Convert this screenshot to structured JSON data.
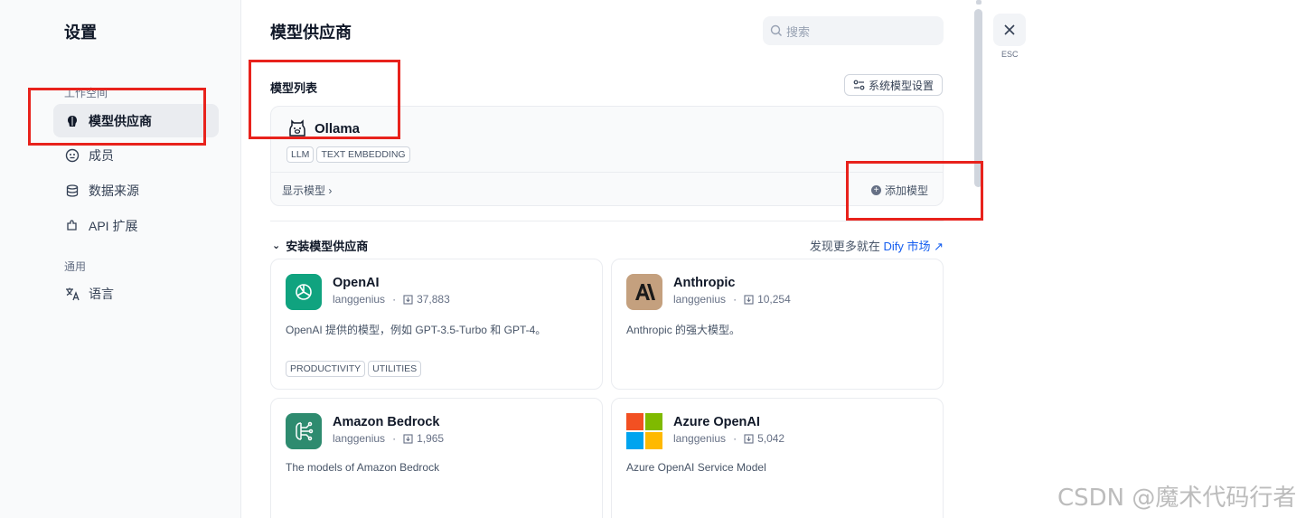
{
  "sidebar": {
    "title": "设置",
    "workspace_label": "工作空间",
    "items": [
      {
        "label": "模型供应商",
        "icon": "brain-icon",
        "active": true
      },
      {
        "label": "成员",
        "icon": "members-icon"
      },
      {
        "label": "数据来源",
        "icon": "database-icon"
      },
      {
        "label": "API 扩展",
        "icon": "puzzle-icon"
      }
    ],
    "general_label": "通用",
    "general_items": [
      {
        "label": "语言",
        "icon": "translate-icon"
      }
    ]
  },
  "main": {
    "title": "模型供应商",
    "search_placeholder": "搜索",
    "model_list_title": "模型列表",
    "system_settings_label": "系统模型设置",
    "ollama": {
      "name": "Ollama",
      "tags": [
        "LLM",
        "TEXT EMBEDDING"
      ],
      "show_models": "显示模型",
      "add_model": "添加模型"
    },
    "install_title": "安装模型供应商",
    "market_prefix": "发现更多就在",
    "market_link": "Dify 市场",
    "providers": [
      {
        "name": "OpenAI",
        "author": "langgenius",
        "installs": "37,883",
        "desc": "OpenAI 提供的模型，例如 GPT-3.5-Turbo 和 GPT-4。",
        "tags": [
          "PRODUCTIVITY",
          "UTILITIES"
        ],
        "logo": "openai-icon",
        "color": "#10a37f"
      },
      {
        "name": "Anthropic",
        "author": "langgenius",
        "installs": "10,254",
        "desc": "Anthropic 的强大模型。",
        "tags": [],
        "logo": "anthropic-icon",
        "color": "#c4a07e"
      },
      {
        "name": "Amazon Bedrock",
        "author": "langgenius",
        "installs": "1,965",
        "desc": "The models of Amazon Bedrock",
        "tags": [],
        "logo": "bedrock-icon",
        "color": "#2e8b6f"
      },
      {
        "name": "Azure OpenAI",
        "author": "langgenius",
        "installs": "5,042",
        "desc": "Azure OpenAI Service Model",
        "tags": [],
        "logo": "microsoft-icon",
        "color": "#f25022"
      }
    ]
  },
  "close": {
    "esc_label": "ESC"
  },
  "watermark": "CSDN @魔术代码行者",
  "colors": {
    "highlight": "#e8221c",
    "link": "#155eef"
  }
}
